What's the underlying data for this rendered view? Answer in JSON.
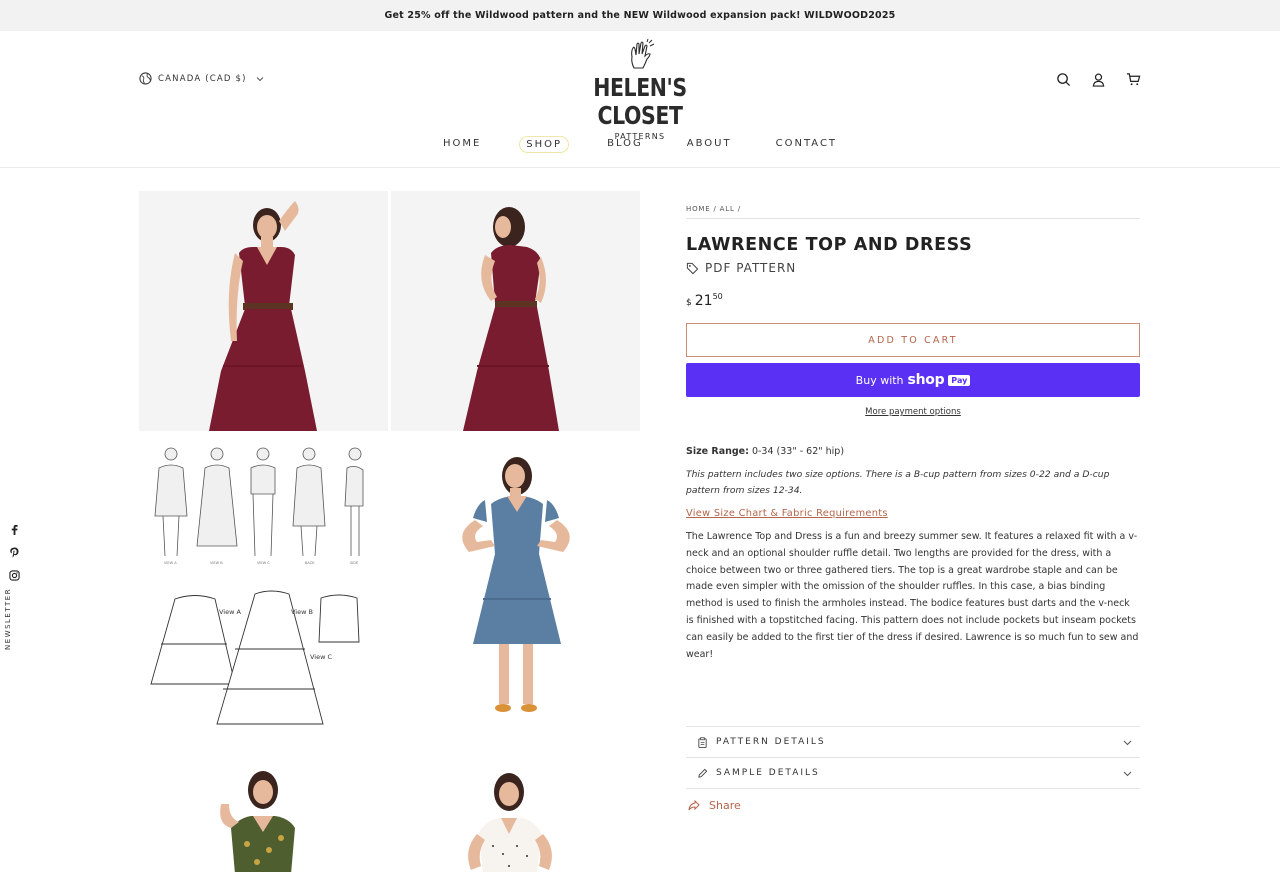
{
  "announcement": "Get 25% off the Wildwood pattern and the NEW Wildwood expansion pack! WILDWOOD2025",
  "header": {
    "currency": "CANADA (CAD $)",
    "logo_title": "HELEN'S CLOSET",
    "logo_sub": "PATTERNS",
    "icons": [
      "search-icon",
      "account-icon",
      "cart-icon"
    ]
  },
  "nav": [
    {
      "label": "HOME"
    },
    {
      "label": "SHOP",
      "active": true
    },
    {
      "label": "BLOG"
    },
    {
      "label": "ABOUT"
    },
    {
      "label": "CONTACT"
    }
  ],
  "social": {
    "icons": [
      "facebook-icon",
      "pinterest-icon",
      "instagram-icon"
    ],
    "newsletter": "NEWSLETTER"
  },
  "product": {
    "breadcrumb": [
      "HOME",
      "ALL"
    ],
    "breadcrumb_sep": "/",
    "title": "LAWRENCE TOP AND DRESS",
    "type": "PDF PATTERN",
    "price_currency": "$",
    "price_whole": "21",
    "price_cents": "50",
    "add_to_cart": "ADD TO CART",
    "buy_with": "Buy with",
    "shop_word": "shop",
    "pay_word": "Pay",
    "more_payment": "More payment options",
    "size_range_label": "Size Range:",
    "size_range_value": "0-34 (33\" - 62\" hip)",
    "size_note": "This pattern includes two size options. There is a B-cup pattern from sizes 0-22 and a D-cup pattern from sizes 12-34.",
    "size_chart_link": "View Size Chart & Fabric Requirements",
    "description": "The Lawrence Top and Dress is a fun and breezy summer sew. It features a relaxed fit with a v-neck and an optional shoulder ruffle detail. Two lengths are provided for the dress, with a choice between two or three gathered tiers. The top is a great wardrobe staple and can be made even simpler with the omission of the shoulder ruffles. In this case, a bias binding method is used to finish the armholes instead. The bodice features bust darts and the v-neck is finished with a topstitched facing. This pattern does not include pockets but inseam pockets can easily be added to the first tier of the dress if desired. Lawrence is so much fun to sew and wear!",
    "accordions": [
      "PATTERN DETAILS",
      "SAMPLE DETAILS"
    ],
    "share": "Share"
  },
  "gallery": {
    "drawing_labels": [
      "View A",
      "View B",
      "View C"
    ],
    "tiny_labels": [
      "VIEW A",
      "VIEW B",
      "VIEW C",
      "BACK",
      "SIDE"
    ]
  },
  "colors": {
    "accent": "#b4654a",
    "shop_pay": "#5a31f4",
    "announcement_bg": "#f2f2f2",
    "dress_burgundy": "#7a1c2f",
    "dress_blue": "#5b7ea3"
  }
}
